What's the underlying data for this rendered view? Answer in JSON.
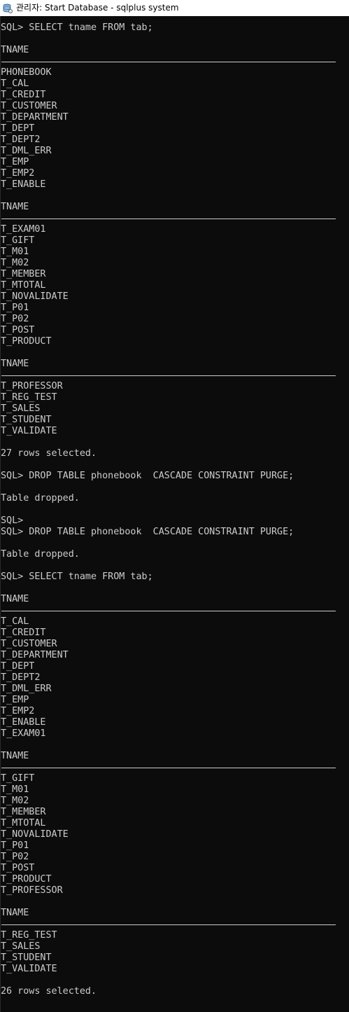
{
  "window": {
    "title": "관리자: Start Database - sqlplus  system",
    "icon": "sqlplus-database-icon"
  },
  "console": {
    "lines": [
      {
        "type": "prompt",
        "text": "SQL> SELECT tname FROM tab;"
      },
      {
        "type": "blank",
        "text": ""
      },
      {
        "type": "header",
        "text": "TNAME"
      },
      {
        "type": "rule",
        "text": ""
      },
      {
        "type": "row",
        "text": "PHONEBOOK"
      },
      {
        "type": "row",
        "text": "T_CAL"
      },
      {
        "type": "row",
        "text": "T_CREDIT"
      },
      {
        "type": "row",
        "text": "T_CUSTOMER"
      },
      {
        "type": "row",
        "text": "T_DEPARTMENT"
      },
      {
        "type": "row",
        "text": "T_DEPT"
      },
      {
        "type": "row",
        "text": "T_DEPT2"
      },
      {
        "type": "row",
        "text": "T_DML_ERR"
      },
      {
        "type": "row",
        "text": "T_EMP"
      },
      {
        "type": "row",
        "text": "T_EMP2"
      },
      {
        "type": "row",
        "text": "T_ENABLE"
      },
      {
        "type": "blank",
        "text": ""
      },
      {
        "type": "header",
        "text": "TNAME"
      },
      {
        "type": "rule",
        "text": ""
      },
      {
        "type": "row",
        "text": "T_EXAM01"
      },
      {
        "type": "row",
        "text": "T_GIFT"
      },
      {
        "type": "row",
        "text": "T_M01"
      },
      {
        "type": "row",
        "text": "T_M02"
      },
      {
        "type": "row",
        "text": "T_MEMBER"
      },
      {
        "type": "row",
        "text": "T_MTOTAL"
      },
      {
        "type": "row",
        "text": "T_NOVALIDATE"
      },
      {
        "type": "row",
        "text": "T_P01"
      },
      {
        "type": "row",
        "text": "T_P02"
      },
      {
        "type": "row",
        "text": "T_POST"
      },
      {
        "type": "row",
        "text": "T_PRODUCT"
      },
      {
        "type": "blank",
        "text": ""
      },
      {
        "type": "header",
        "text": "TNAME"
      },
      {
        "type": "rule",
        "text": ""
      },
      {
        "type": "row",
        "text": "T_PROFESSOR"
      },
      {
        "type": "row",
        "text": "T_REG_TEST"
      },
      {
        "type": "row",
        "text": "T_SALES"
      },
      {
        "type": "row",
        "text": "T_STUDENT"
      },
      {
        "type": "row",
        "text": "T_VALIDATE"
      },
      {
        "type": "blank",
        "text": ""
      },
      {
        "type": "status",
        "text": "27 rows selected."
      },
      {
        "type": "blank",
        "text": ""
      },
      {
        "type": "prompt",
        "text": "SQL> DROP TABLE phonebook  CASCADE CONSTRAINT PURGE;"
      },
      {
        "type": "blank",
        "text": ""
      },
      {
        "type": "status",
        "text": "Table dropped."
      },
      {
        "type": "blank",
        "text": ""
      },
      {
        "type": "prompt",
        "text": "SQL>"
      },
      {
        "type": "prompt",
        "text": "SQL> DROP TABLE phonebook  CASCADE CONSTRAINT PURGE;"
      },
      {
        "type": "blank",
        "text": ""
      },
      {
        "type": "status",
        "text": "Table dropped."
      },
      {
        "type": "blank",
        "text": ""
      },
      {
        "type": "prompt",
        "text": "SQL> SELECT tname FROM tab;"
      },
      {
        "type": "blank",
        "text": ""
      },
      {
        "type": "header",
        "text": "TNAME"
      },
      {
        "type": "rule",
        "text": ""
      },
      {
        "type": "row",
        "text": "T_CAL"
      },
      {
        "type": "row",
        "text": "T_CREDIT"
      },
      {
        "type": "row",
        "text": "T_CUSTOMER"
      },
      {
        "type": "row",
        "text": "T_DEPARTMENT"
      },
      {
        "type": "row",
        "text": "T_DEPT"
      },
      {
        "type": "row",
        "text": "T_DEPT2"
      },
      {
        "type": "row",
        "text": "T_DML_ERR"
      },
      {
        "type": "row",
        "text": "T_EMP"
      },
      {
        "type": "row",
        "text": "T_EMP2"
      },
      {
        "type": "row",
        "text": "T_ENABLE"
      },
      {
        "type": "row",
        "text": "T_EXAM01"
      },
      {
        "type": "blank",
        "text": ""
      },
      {
        "type": "header",
        "text": "TNAME"
      },
      {
        "type": "rule",
        "text": ""
      },
      {
        "type": "row",
        "text": "T_GIFT"
      },
      {
        "type": "row",
        "text": "T_M01"
      },
      {
        "type": "row",
        "text": "T_M02"
      },
      {
        "type": "row",
        "text": "T_MEMBER"
      },
      {
        "type": "row",
        "text": "T_MTOTAL"
      },
      {
        "type": "row",
        "text": "T_NOVALIDATE"
      },
      {
        "type": "row",
        "text": "T_P01"
      },
      {
        "type": "row",
        "text": "T_P02"
      },
      {
        "type": "row",
        "text": "T_POST"
      },
      {
        "type": "row",
        "text": "T_PRODUCT"
      },
      {
        "type": "row",
        "text": "T_PROFESSOR"
      },
      {
        "type": "blank",
        "text": ""
      },
      {
        "type": "header",
        "text": "TNAME"
      },
      {
        "type": "rule",
        "text": ""
      },
      {
        "type": "row",
        "text": "T_REG_TEST"
      },
      {
        "type": "row",
        "text": "T_SALES"
      },
      {
        "type": "row",
        "text": "T_STUDENT"
      },
      {
        "type": "row",
        "text": "T_VALIDATE"
      },
      {
        "type": "blank",
        "text": ""
      },
      {
        "type": "status",
        "text": "26 rows selected."
      }
    ]
  },
  "colors": {
    "background": "#0c0c0c",
    "foreground": "#cccccc",
    "titlebar": "#ffffff"
  }
}
